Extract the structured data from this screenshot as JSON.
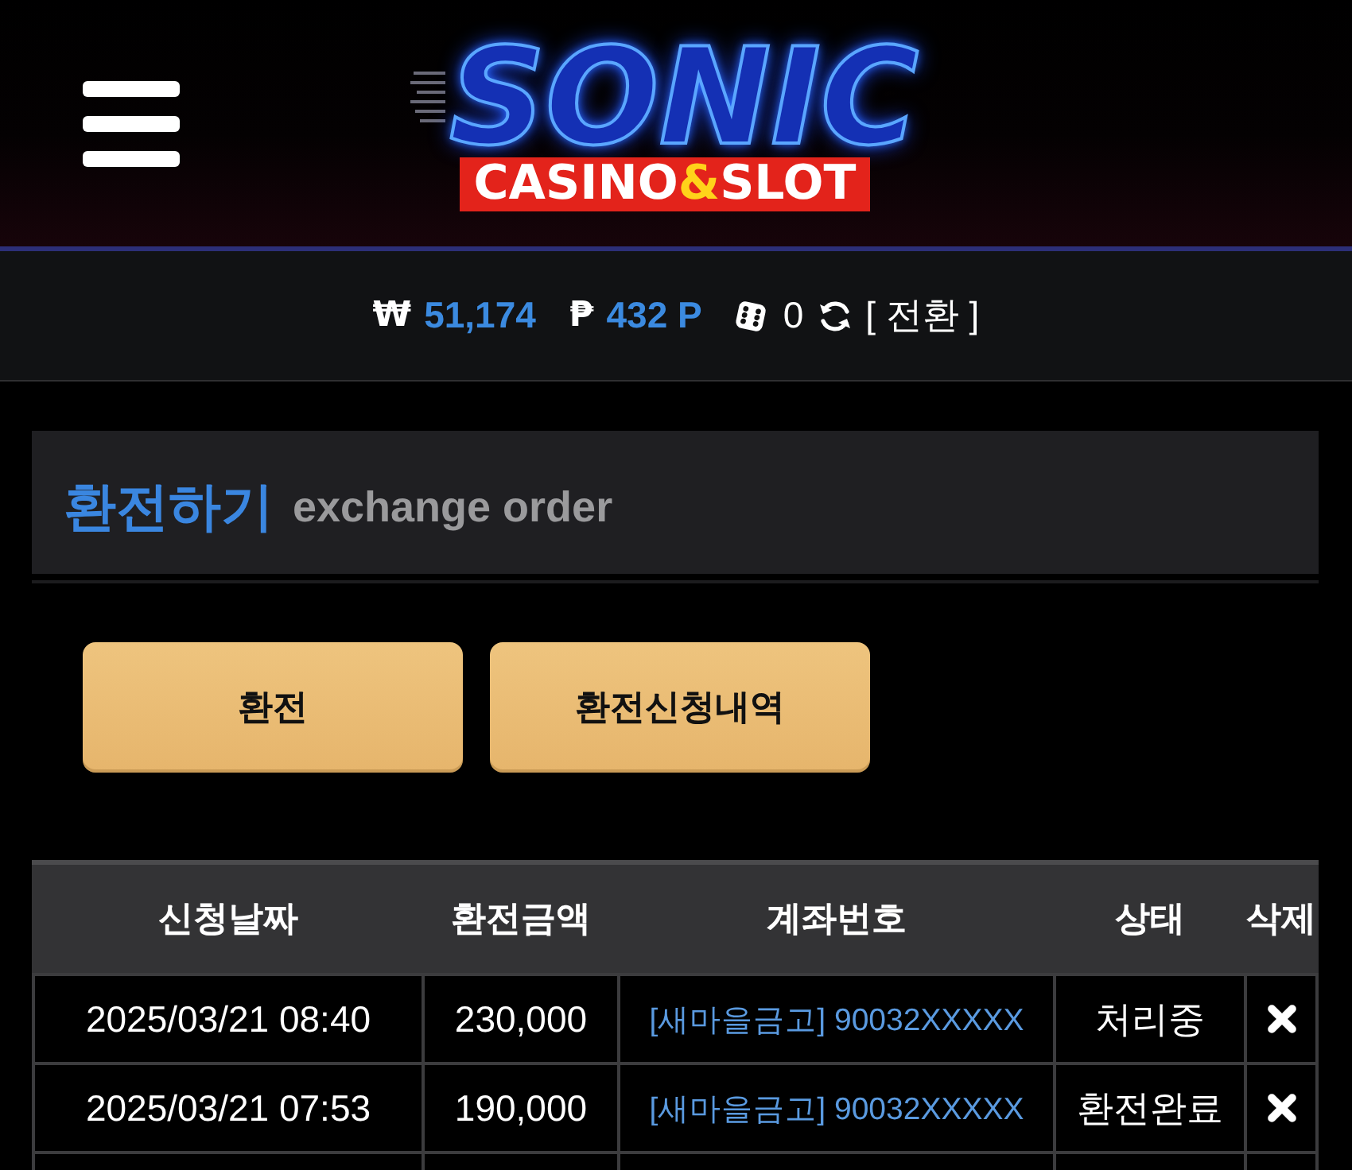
{
  "header": {
    "logo": {
      "title": "SONIC",
      "tagline": [
        {
          "text": "CASINO",
          "accent": false
        },
        {
          "text": "&",
          "accent": true
        },
        {
          "text": "SLOT",
          "accent": false
        }
      ]
    }
  },
  "wallet": {
    "balances": [
      {
        "symbol": "₩",
        "amount": "51,174"
      },
      {
        "symbol": "₱",
        "amount": "432 P"
      }
    ],
    "chips": {
      "count": "0"
    },
    "convert": {
      "label": "[ 전환 ]"
    }
  },
  "section": {
    "title": "환전하기",
    "subtitle": "exchange order"
  },
  "actions": [
    {
      "label": "환전"
    },
    {
      "label": "환전신청내역"
    }
  ],
  "table": {
    "columns": [
      "신청날짜",
      "환전금액",
      "계좌번호",
      "상태",
      "삭제"
    ],
    "rows": [
      {
        "date": "2025/03/21 08:40",
        "amount": "230,000",
        "account": "[새마을금고] 90032XXXXX",
        "status": "처리중"
      },
      {
        "date": "2025/03/21 07:53",
        "amount": "190,000",
        "account": "[새마을금고] 90032XXXXX",
        "status": "환전완료"
      }
    ]
  }
}
